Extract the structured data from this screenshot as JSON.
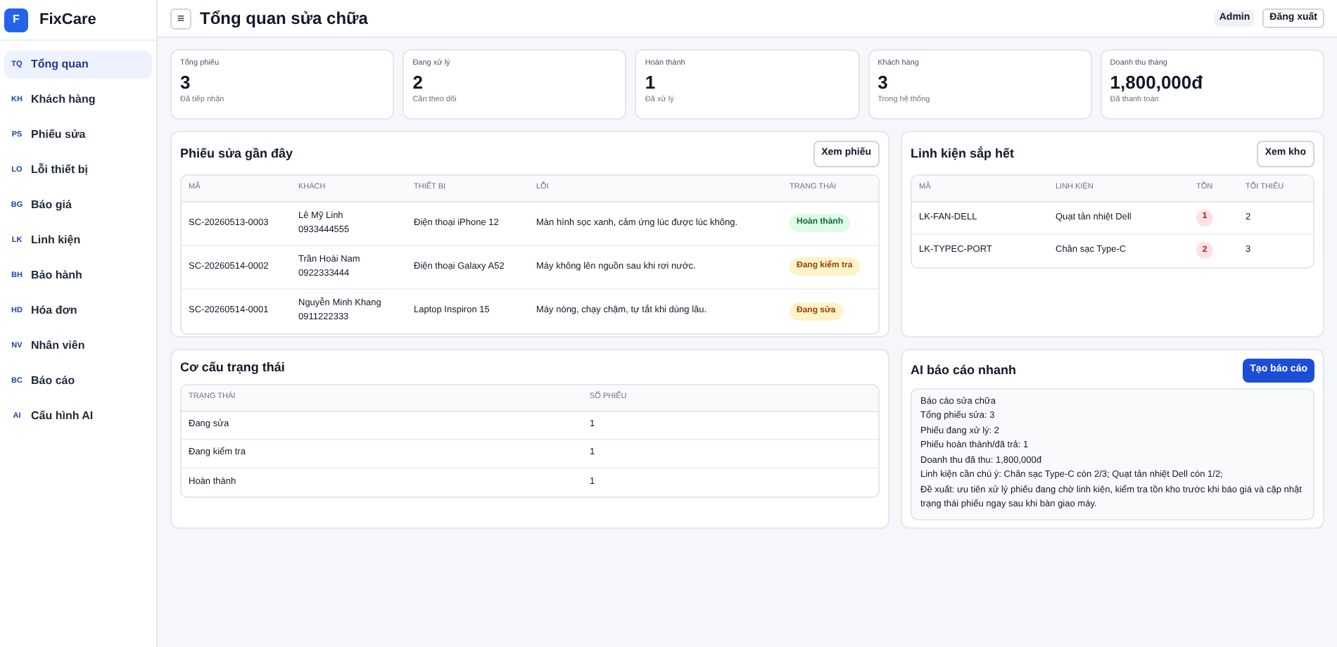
{
  "brand": {
    "logo": "F",
    "name": "FixCare"
  },
  "sidebar": {
    "items": [
      {
        "abbr": "TQ",
        "label": "Tổng quan",
        "selected": true
      },
      {
        "abbr": "KH",
        "label": "Khách hàng",
        "selected": false
      },
      {
        "abbr": "PS",
        "label": "Phiếu sửa",
        "selected": false
      },
      {
        "abbr": "LO",
        "label": "Lỗi thiết bị",
        "selected": false
      },
      {
        "abbr": "BG",
        "label": "Báo giá",
        "selected": false
      },
      {
        "abbr": "LK",
        "label": "Linh kiện",
        "selected": false
      },
      {
        "abbr": "BH",
        "label": "Bảo hành",
        "selected": false
      },
      {
        "abbr": "HD",
        "label": "Hóa đơn",
        "selected": false
      },
      {
        "abbr": "NV",
        "label": "Nhân viên",
        "selected": false
      },
      {
        "abbr": "BC",
        "label": "Báo cáo",
        "selected": false
      },
      {
        "abbr": "AI",
        "label": "Cấu hình AI",
        "selected": false
      }
    ]
  },
  "header": {
    "menu": "≡",
    "title": "Tổng quan sửa chữa",
    "role": "Admin",
    "logout": "Đăng xuất"
  },
  "stats": [
    {
      "label": "Tổng phiếu",
      "value": "3",
      "note": "Đã tiếp nhận"
    },
    {
      "label": "Đang xử lý",
      "value": "2",
      "note": "Cần theo dõi"
    },
    {
      "label": "Hoàn thành",
      "value": "1",
      "note": "Đã xử lý"
    },
    {
      "label": "Khách hàng",
      "value": "3",
      "note": "Trong hệ thống"
    },
    {
      "label": "Doanh thu tháng",
      "value": "1,800,000đ",
      "note": "Đã thanh toán"
    }
  ],
  "recent": {
    "title": "Phiếu sửa gần đây",
    "button": "Xem phiếu",
    "columns": [
      "MÃ",
      "KHÁCH",
      "THIẾT BỊ",
      "LỖI",
      "TRẠNG THÁI"
    ],
    "rows": [
      {
        "code": "SC-20260513-0003",
        "customer": "Lê Mỹ Linh",
        "phone": "0933444555",
        "device": "Điện thoại iPhone 12",
        "issue": "Màn hình sọc xanh, cảm ứng lúc được lúc không.",
        "status": {
          "label": "Hoàn thành",
          "kind": "done"
        }
      },
      {
        "code": "SC-20260514-0002",
        "customer": "Trần Hoài Nam",
        "phone": "0922333444",
        "device": "Điện thoại Galaxy A52",
        "issue": "Máy không lên nguồn sau khi rơi nước.",
        "status": {
          "label": "Đang kiểm tra",
          "kind": "pending"
        }
      },
      {
        "code": "SC-20260514-0001",
        "customer": "Nguyễn Minh Khang",
        "phone": "0911222333",
        "device": "Laptop Inspiron 15",
        "issue": "Máy nóng, chạy chậm, tự tắt khi dùng lâu.",
        "status": {
          "label": "Đang sửa",
          "kind": "pending"
        }
      }
    ]
  },
  "low_stock": {
    "title": "Linh kiện sắp hết",
    "button": "Xem kho",
    "columns": [
      "MÃ",
      "LINH KIỆN",
      "TỒN",
      "TỐI THIỂU"
    ],
    "rows": [
      {
        "code": "LK-FAN-DELL",
        "name": "Quạt tản nhiệt Dell",
        "stock": "1",
        "min": "2"
      },
      {
        "code": "LK-TYPEC-PORT",
        "name": "Chân sạc Type-C",
        "stock": "2",
        "min": "3"
      }
    ]
  },
  "status_breakdown": {
    "title": "Cơ cấu trạng thái",
    "columns": [
      "TRẠNG THÁI",
      "SỐ PHIẾU"
    ],
    "rows": [
      {
        "status": "Đang sửa",
        "count": "1"
      },
      {
        "status": "Đang kiểm tra",
        "count": "1"
      },
      {
        "status": "Hoàn thành",
        "count": "1"
      }
    ]
  },
  "ai_report": {
    "title": "AI báo cáo nhanh",
    "button": "Tạo báo cáo",
    "lines": [
      "Báo cáo sửa chữa",
      "Tổng phiếu sửa: 3",
      "Phiếu đang xử lý: 2",
      "Phiếu hoàn thành/đã trả: 1",
      "Doanh thu đã thu: 1,800,000đ",
      "Linh kiện cần chú ý: Chân sạc Type-C còn 2/3; Quạt tản nhiệt Dell còn 1/2;",
      "Đề xuất: ưu tiên xử lý phiếu đang chờ linh kiện, kiểm tra tồn kho trước khi báo giá và cập nhật trạng thái phiếu ngay sau khi bàn giao máy."
    ]
  }
}
